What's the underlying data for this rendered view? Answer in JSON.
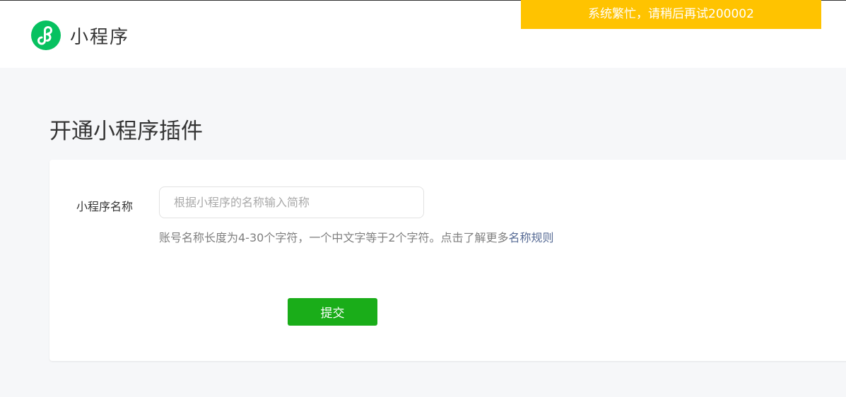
{
  "header": {
    "brand": "小程序",
    "logo_icon": "miniprogram-logo-icon",
    "brand_color": "#07c160"
  },
  "toast": {
    "message": "系统繁忙，请稍后再试200002",
    "color": "#ffc300"
  },
  "page": {
    "title": "开通小程序插件"
  },
  "form": {
    "name_label": "小程序名称",
    "name_placeholder": "根据小程序的名称输入简称",
    "name_value": "",
    "hint_text": "账号名称长度为4-30个字符，一个中文字等于2个字符。点击了解更多",
    "hint_link": "名称规则",
    "submit_label": "提交",
    "submit_color": "#1aad19"
  }
}
